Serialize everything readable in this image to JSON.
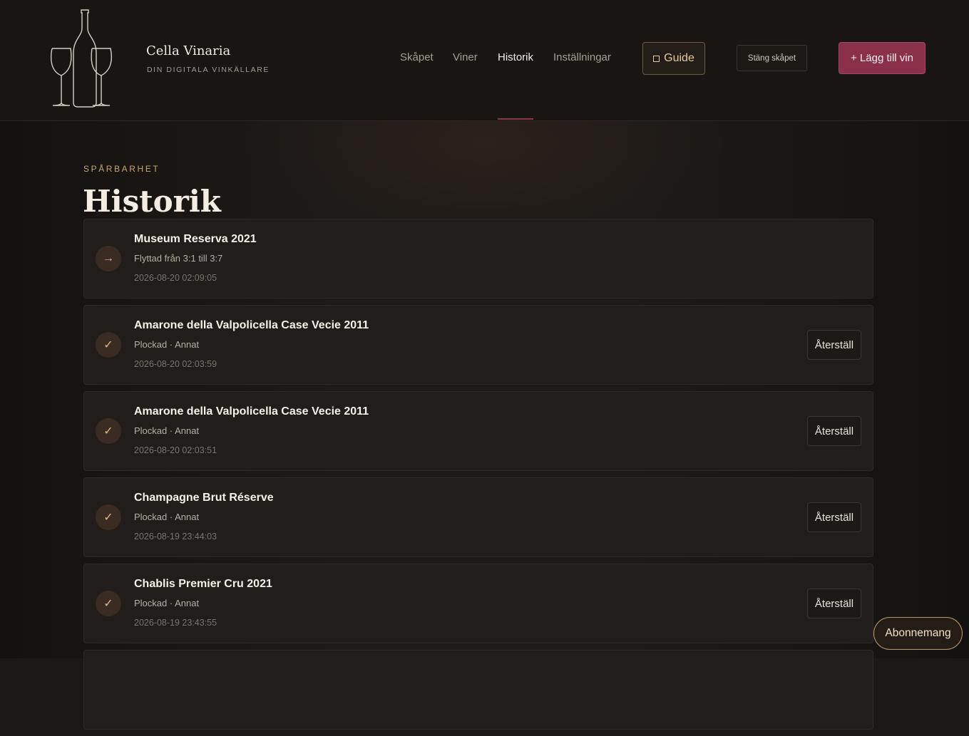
{
  "brand": {
    "name": "Cella Vinaria",
    "tagline": "DIN DIGITALA VINKÄLLARE"
  },
  "nav": {
    "items": [
      {
        "label": "Skåpet",
        "active": false
      },
      {
        "label": "Viner",
        "active": false
      },
      {
        "label": "Historik",
        "active": true
      },
      {
        "label": "Inställningar",
        "active": false
      }
    ]
  },
  "actions": {
    "guide_label": "Guide",
    "close_label": "Stäng skåpet",
    "add_label": "+ Lägg till vin"
  },
  "page": {
    "eyebrow": "SPÅRBARHET",
    "title": "Historik"
  },
  "history": [
    {
      "icon": "arrow-right-icon",
      "glyph": "→",
      "name": "Museum Reserva 2021",
      "detail": "Flyttad från 3:1 till 3:7",
      "time": "2026-08-20 02:09:05",
      "restore": ""
    },
    {
      "icon": "check-icon",
      "glyph": "✓",
      "name": "Amarone della Valpolicella Case Vecie 2011",
      "detail": "Plockad · Annat",
      "time": "2026-08-20 02:03:59",
      "restore": "Återställ"
    },
    {
      "icon": "check-icon",
      "glyph": "✓",
      "name": "Amarone della Valpolicella Case Vecie 2011",
      "detail": "Plockad · Annat",
      "time": "2026-08-20 02:03:51",
      "restore": "Återställ"
    },
    {
      "icon": "check-icon",
      "glyph": "✓",
      "name": "Champagne Brut Réserve",
      "detail": "Plockad · Annat",
      "time": "2026-08-19 23:44:03",
      "restore": "Återställ"
    },
    {
      "icon": "check-icon",
      "glyph": "✓",
      "name": "Chablis Premier Cru 2021",
      "detail": "Plockad · Annat",
      "time": "2026-08-19 23:43:55",
      "restore": "Återställ"
    }
  ],
  "subscribe_label": "Abonnemang",
  "colors": {
    "accent": "#8a3149",
    "gold": "#c9a66a",
    "background": "#1b1815"
  }
}
